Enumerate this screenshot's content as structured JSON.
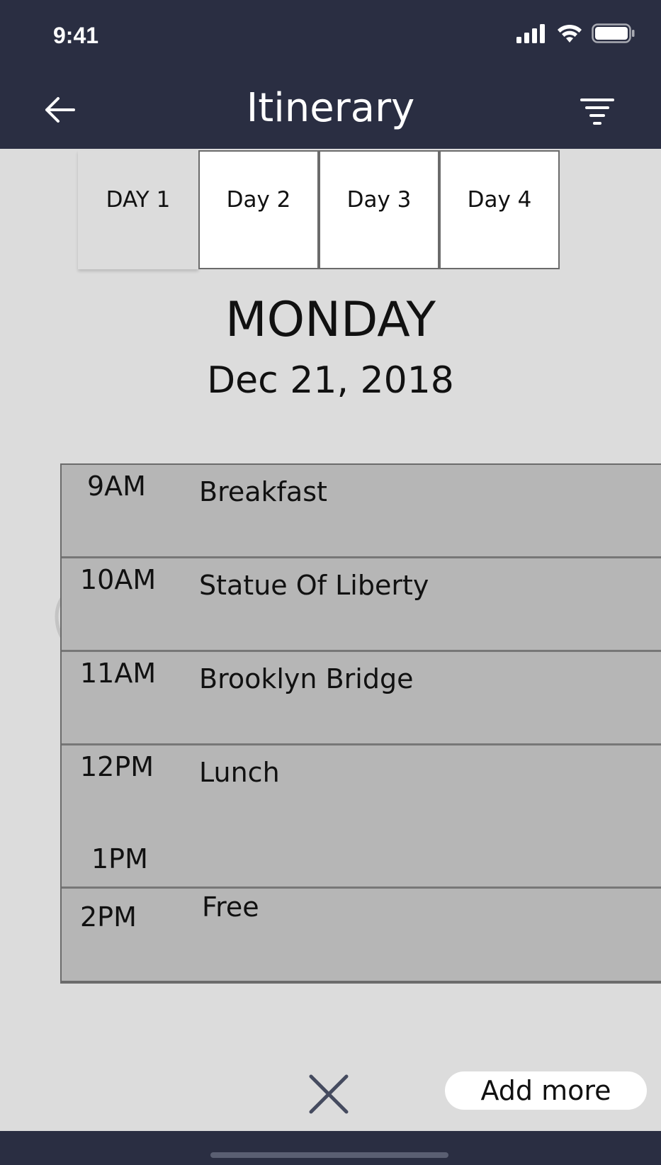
{
  "status_bar": {
    "time": "9:41"
  },
  "nav": {
    "title": "Itinerary"
  },
  "tabs": [
    {
      "label": "DAY 1"
    },
    {
      "label": "Day 2"
    },
    {
      "label": "Day 3"
    },
    {
      "label": "Day 4"
    }
  ],
  "day": {
    "name": "MONDAY",
    "date": "Dec 21, 2018"
  },
  "schedule": [
    {
      "time": "9AM",
      "event": "Breakfast"
    },
    {
      "time": "10AM",
      "event": "Statue Of Liberty"
    },
    {
      "time": "11AM",
      "event": "Brooklyn Bridge"
    },
    {
      "time": "12PM",
      "end_time": "1PM",
      "event": "Lunch"
    },
    {
      "time": "2PM",
      "event": "Free"
    }
  ],
  "actions": {
    "add_more_label": "Add more"
  },
  "colors": {
    "header_bg": "#2a2e42",
    "content_bg": "#dcdcdc",
    "row_bg": "#b6b6b6"
  },
  "icons": {
    "back": "arrow-left-icon",
    "filter": "filter-icon",
    "close": "close-icon"
  }
}
